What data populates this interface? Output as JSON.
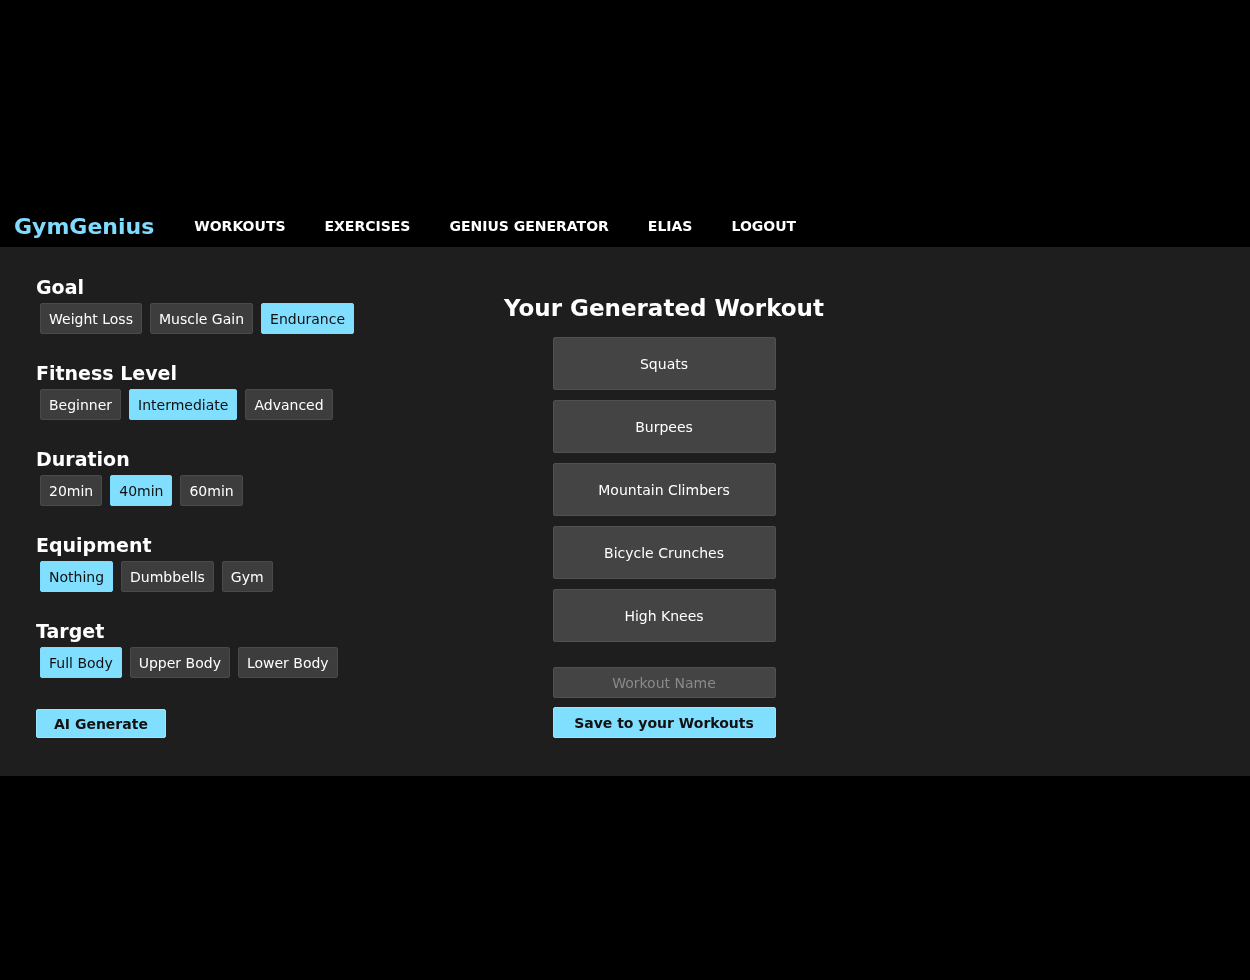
{
  "navbar": {
    "logo": "GymGenius",
    "links": [
      "WORKOUTS",
      "EXERCISES",
      "GENIUS GENERATOR",
      "ELIAS",
      "LOGOUT"
    ]
  },
  "filters": [
    {
      "heading": "Goal",
      "options": [
        {
          "label": "Weight Loss",
          "selected": false
        },
        {
          "label": "Muscle Gain",
          "selected": false
        },
        {
          "label": "Endurance",
          "selected": true
        }
      ]
    },
    {
      "heading": "Fitness Level",
      "options": [
        {
          "label": "Beginner",
          "selected": false
        },
        {
          "label": "Intermediate",
          "selected": true
        },
        {
          "label": "Advanced",
          "selected": false
        }
      ]
    },
    {
      "heading": "Duration",
      "options": [
        {
          "label": "20min",
          "selected": false
        },
        {
          "label": "40min",
          "selected": true
        },
        {
          "label": "60min",
          "selected": false
        }
      ]
    },
    {
      "heading": "Equipment",
      "options": [
        {
          "label": "Nothing",
          "selected": true
        },
        {
          "label": "Dumbbells",
          "selected": false
        },
        {
          "label": "Gym",
          "selected": false
        }
      ]
    },
    {
      "heading": "Target",
      "options": [
        {
          "label": "Full Body",
          "selected": true
        },
        {
          "label": "Upper Body",
          "selected": false
        },
        {
          "label": "Lower Body",
          "selected": false
        }
      ]
    }
  ],
  "generate_button": "AI Generate",
  "workout": {
    "title": "Your Generated Workout",
    "exercises": [
      "Squats",
      "Burpees",
      "Mountain Climbers",
      "Bicycle Crunches",
      "High Knees"
    ],
    "name_field": {
      "placeholder": "Workout Name"
    },
    "save_button": "Save to your Workouts"
  }
}
